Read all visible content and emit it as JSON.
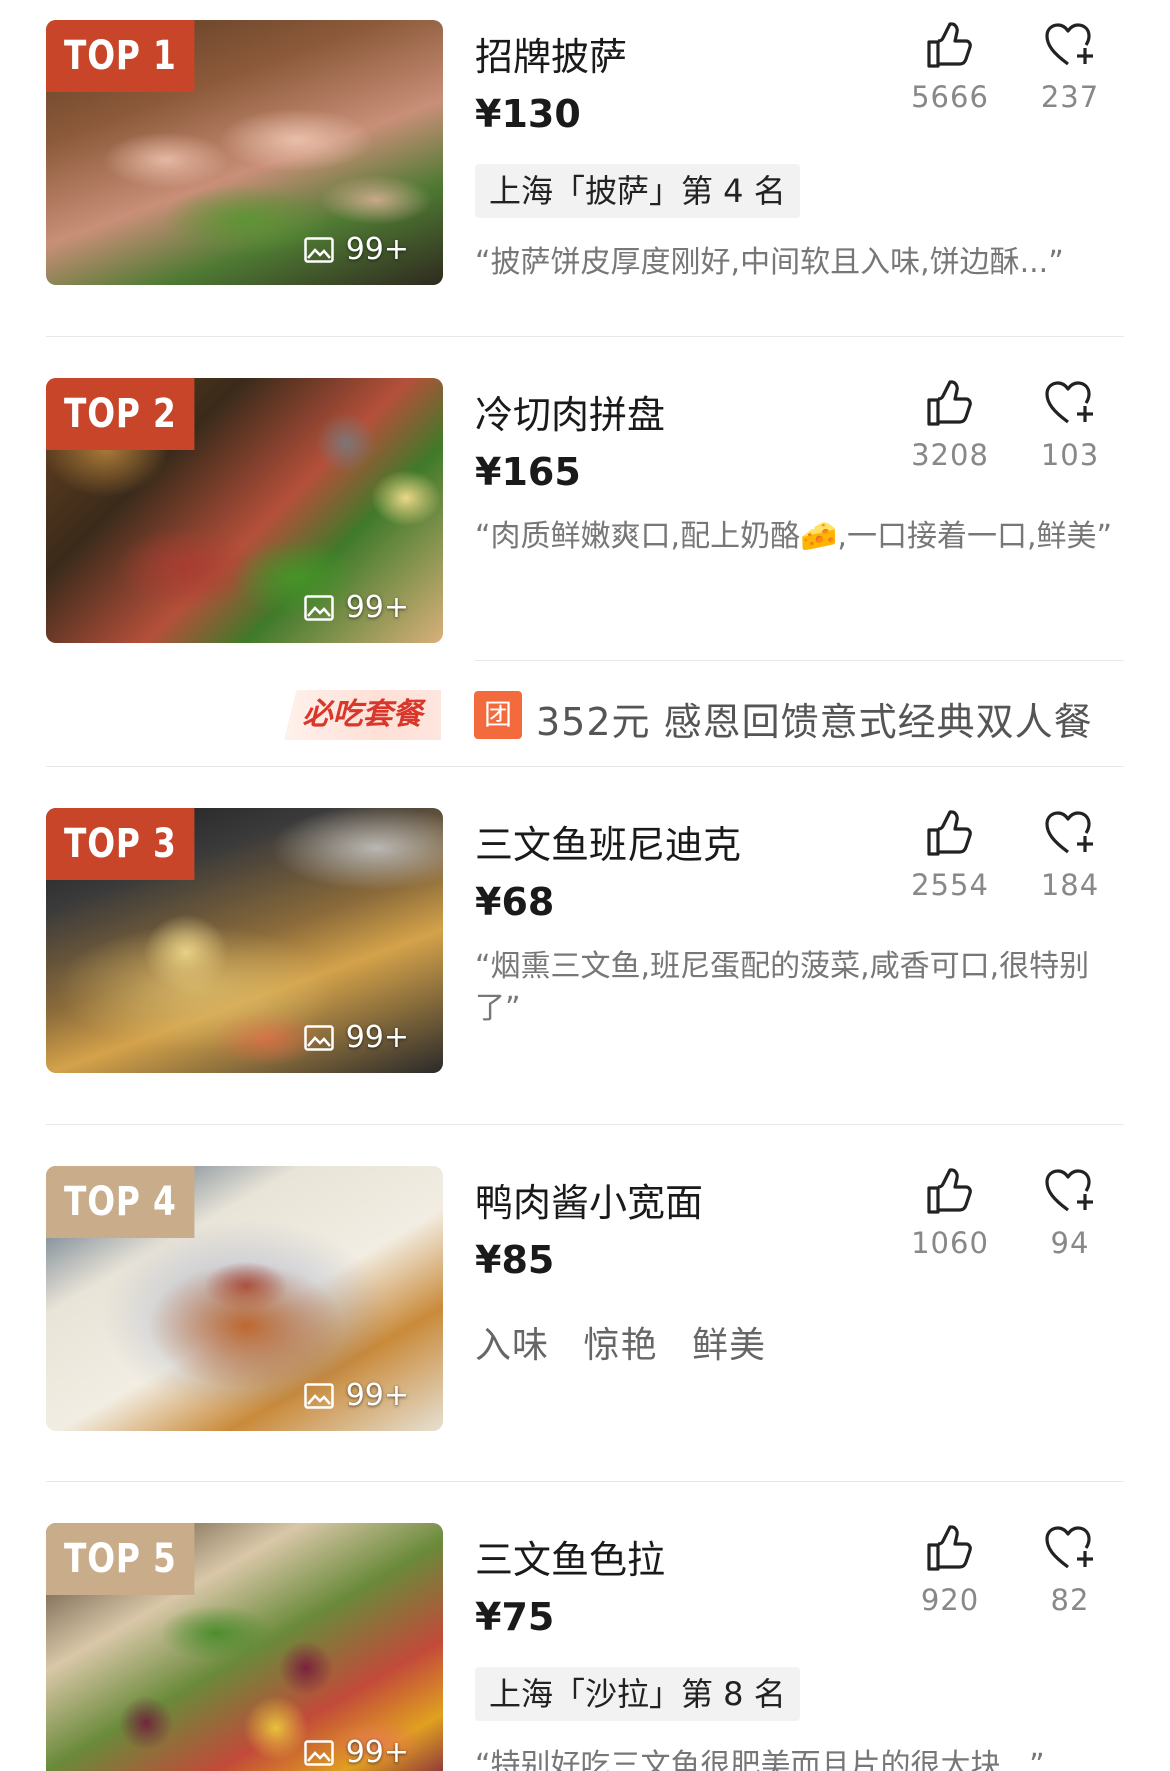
{
  "dishes": [
    {
      "rank": "TOP 1",
      "name": "招牌披萨",
      "price": "¥130",
      "likes": "5666",
      "favorites": "237",
      "photo_count": "99+",
      "rank_tag": "上海「披萨」第 4 名",
      "quote": "“披萨饼皮厚度刚好,中间软且入味,饼边酥...”"
    },
    {
      "rank": "TOP 2",
      "name": "冷切肉拼盘",
      "price": "¥165",
      "likes": "3208",
      "favorites": "103",
      "photo_count": "99+",
      "quote": "“肉质鲜嫩爽口,配上奶酪🧀,一口接着一口,鲜美”"
    },
    {
      "rank": "TOP 3",
      "name": "三文鱼班尼迪克",
      "price": "¥68",
      "likes": "2554",
      "favorites": "184",
      "photo_count": "99+",
      "quote": "“烟熏三文鱼,班尼蛋配的菠菜,咸香可口,很特别了”"
    },
    {
      "rank": "TOP 4",
      "name": "鸭肉酱小宽面",
      "price": "¥85",
      "likes": "1060",
      "favorites": "94",
      "photo_count": "99+",
      "tags": [
        "入味",
        "惊艳",
        "鲜美"
      ]
    },
    {
      "rank": "TOP 5",
      "name": "三文鱼色拉",
      "price": "¥75",
      "likes": "920",
      "favorites": "82",
      "photo_count": "99+",
      "rank_tag": "上海「沙拉」第 8 名",
      "quote": "“特别好吃三文鱼很肥美而且片的很大块...”"
    }
  ],
  "set_meal": {
    "badge": "必吃套餐",
    "icon_label": "团",
    "text": "352元 感恩回馈意式经典双人餐"
  },
  "icons": {
    "like": "thumbs-up-icon",
    "favorite": "heart-plus-icon",
    "photos": "image-icon"
  },
  "colors": {
    "rank_top": "#c8452a",
    "rank_other": "#c9ad8a",
    "group_icon": "#f36b3d",
    "must_eat_text": "#d9372b"
  }
}
